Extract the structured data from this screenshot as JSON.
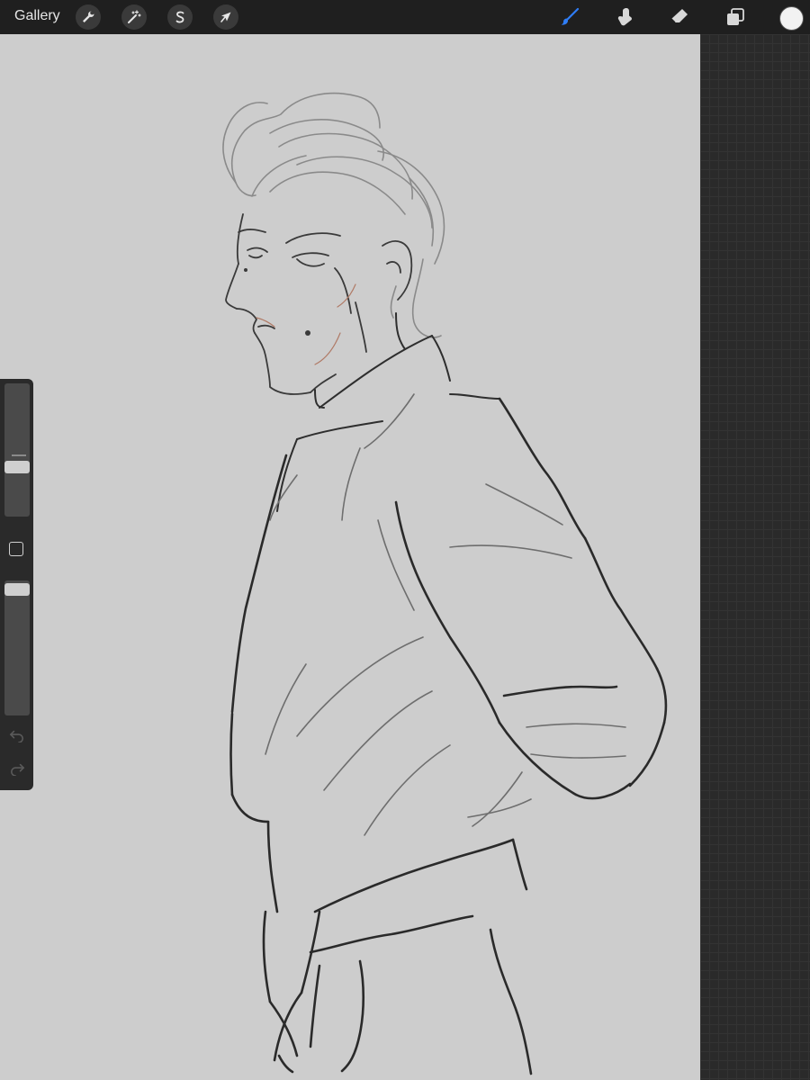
{
  "toolbar": {
    "gallery_label": "Gallery",
    "left_tools": [
      {
        "name": "actions",
        "icon": "wrench-icon"
      },
      {
        "name": "adjustments",
        "icon": "magic-wand-icon"
      },
      {
        "name": "selection",
        "icon": "selection-s-icon"
      },
      {
        "name": "transform",
        "icon": "arrow-cursor-icon"
      }
    ],
    "right_tools": [
      {
        "name": "brush",
        "icon": "brush-icon",
        "active": true
      },
      {
        "name": "smudge",
        "icon": "smudge-finger-icon",
        "active": false
      },
      {
        "name": "eraser",
        "icon": "eraser-icon",
        "active": false
      },
      {
        "name": "layers",
        "icon": "layers-icon",
        "active": false
      }
    ],
    "current_color": "#f2f2f2"
  },
  "sidebar": {
    "brush_size_level": 0.35,
    "opacity_level": 1.0
  },
  "colors": {
    "toolbar_bg": "#1f1f1f",
    "canvas_bg": "#cdcdcd",
    "accent": "#2f7df6"
  }
}
